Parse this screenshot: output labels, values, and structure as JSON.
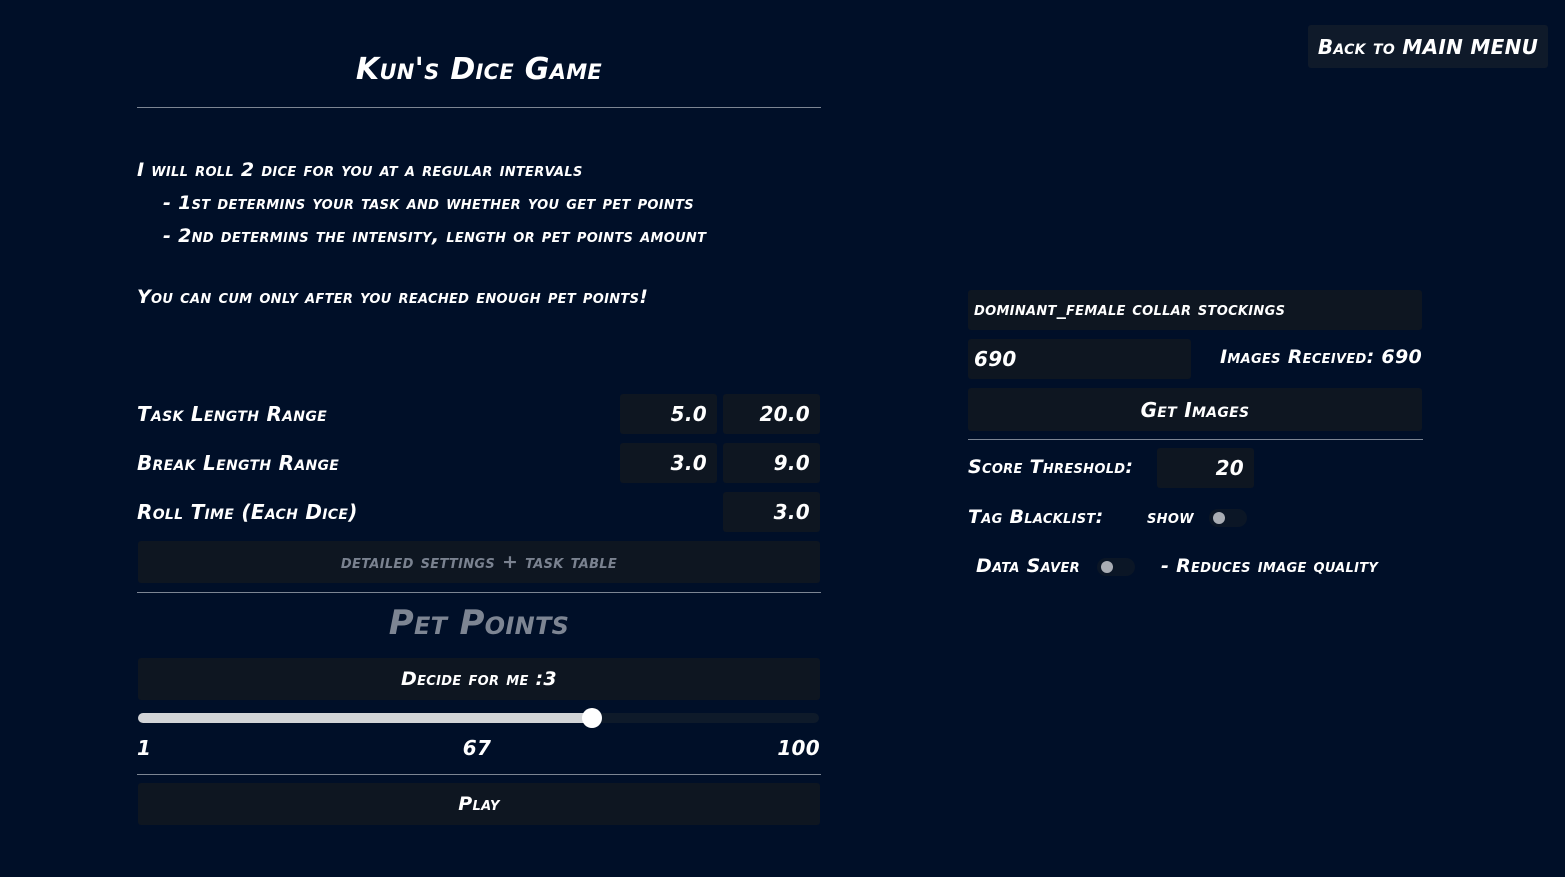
{
  "header": {
    "back_label": "Back to MAIN MENU",
    "title": "Kun's Dice Game"
  },
  "intro": {
    "line1": "I will roll 2 dice for you at a regular intervals",
    "line2": "- 1st determins your task and whether you get pet points",
    "line3": "- 2nd determins the intensity, length or pet points amount",
    "note": "You can cum only after you reached enough pet points!"
  },
  "settings": {
    "task_length": {
      "label": "Task Length Range",
      "min": "5.0",
      "max": "20.0"
    },
    "break_length": {
      "label": "Break Length Range",
      "min": "3.0",
      "max": "9.0"
    },
    "roll_time": {
      "label": "Roll Time (Each Dice)",
      "value": "3.0"
    },
    "details_label": "detailed settings + task table"
  },
  "pet_points": {
    "title": "Pet Points",
    "decide_label": "Decide for me :3",
    "slider": {
      "min_label": "1",
      "value_label": "67",
      "max_label": "100",
      "fill_fraction": 0.667
    },
    "play_label": "Play"
  },
  "images": {
    "tags_value": "dominant_female collar stockings",
    "count_value": "690",
    "received_label": "Images Received: 690",
    "get_label": "Get Images",
    "score_label": "Score Threshold:",
    "score_value": "20",
    "blacklist_label": "Tag Blacklist:",
    "blacklist_toggle_label": "show",
    "datasaver_label": "Data Saver",
    "datasaver_note": "- Reduces image quality"
  },
  "colors": {
    "background": "#000f28",
    "panel": "#0e1621",
    "muted_text": "#7a8290"
  }
}
